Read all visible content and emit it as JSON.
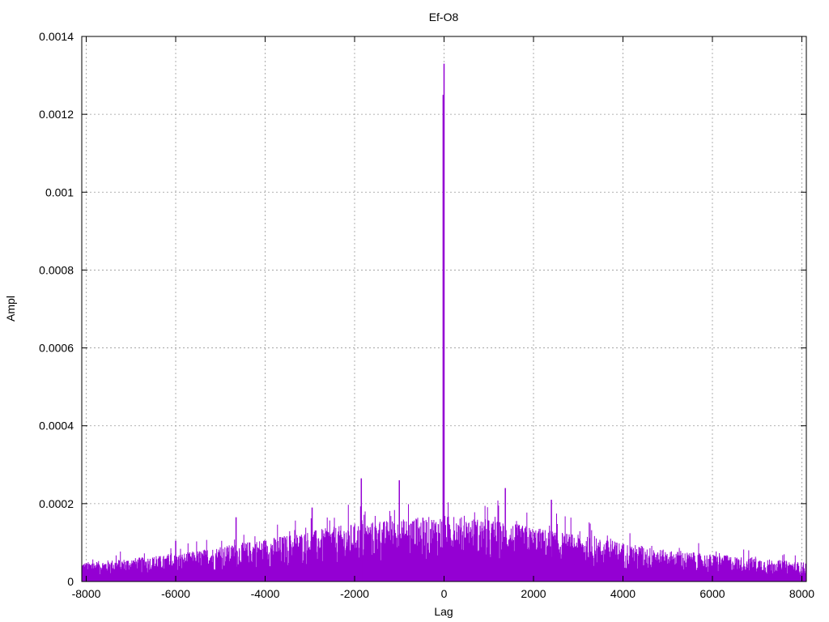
{
  "chart_data": {
    "type": "bar",
    "title": "Ef-O8",
    "xlabel": "Lag",
    "ylabel": "Ampl",
    "xlim": [
      -8100,
      8100
    ],
    "ylim": [
      0,
      0.0014
    ],
    "grid": true,
    "x_ticks": [
      "-8000",
      "-6000",
      "-4000",
      "-2000",
      "0",
      "2000",
      "4000",
      "6000",
      "8000"
    ],
    "y_ticks": [
      "0",
      "0.0002",
      "0.0004",
      "0.0006",
      "0.0008",
      "0.001",
      "0.0012",
      "0.0014"
    ],
    "x_tick_values": [
      -8000,
      -6000,
      -4000,
      -2000,
      0,
      2000,
      4000,
      6000,
      8000
    ],
    "y_tick_values": [
      0,
      0.0002,
      0.0004,
      0.0006,
      0.0008,
      0.001,
      0.0012,
      0.0014
    ],
    "series": [
      {
        "color": "#9400d3",
        "envelope_x": [
          -8100,
          -8000,
          -7000,
          -6000,
          -5000,
          -4000,
          -3000,
          -2000,
          -1000,
          0,
          1000,
          2000,
          3000,
          4000,
          5000,
          6000,
          7000,
          8000,
          8100
        ],
        "envelope_y": [
          5e-05,
          5e-05,
          6e-05,
          7e-05,
          9e-05,
          0.00011,
          0.00013,
          0.00015,
          0.00016,
          0.00017,
          0.00016,
          0.00014,
          0.00012,
          0.0001,
          8e-05,
          7e-05,
          6e-05,
          5e-05,
          5e-05
        ],
        "peaks": [
          {
            "x": 0,
            "y": 0.00133
          },
          {
            "x": -20,
            "y": 0.00125
          },
          {
            "x": -1850,
            "y": 0.000265
          },
          {
            "x": -1000,
            "y": 0.00026
          },
          {
            "x": 1370,
            "y": 0.00024
          },
          {
            "x": -2950,
            "y": 0.00019
          },
          {
            "x": -4650,
            "y": 0.000165
          },
          {
            "x": 2400,
            "y": 0.00021
          },
          {
            "x": -6000,
            "y": 0.000105
          }
        ]
      }
    ]
  }
}
